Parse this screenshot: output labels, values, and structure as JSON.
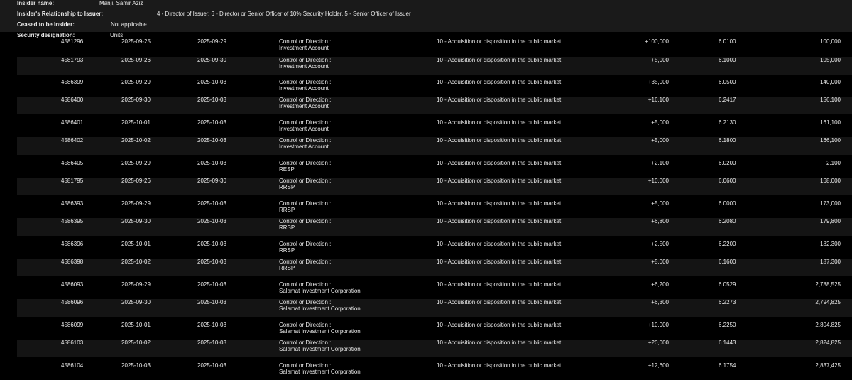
{
  "colors": {
    "page_background": "#000000",
    "header_background": "#1a1a1a",
    "row_band": "#141414",
    "text": "#e8e8e8"
  },
  "insider": {
    "name_label": "Insider name:",
    "name": "Manji, Samir Aziz",
    "relationship_label": "Insider's Relationship to Issuer:",
    "relationship": "4 - Director of Issuer, 6 - Director or Senior Officer of 10% Security Holder, 5 - Senior Officer of Issuer",
    "ceased_label": "Ceased to be Insider:",
    "ceased": "Not applicable",
    "security_label": "Security designation:",
    "security": "Units"
  },
  "transactions": [
    {
      "id": "4581296",
      "transaction_date": "2025-09-25",
      "filing_date": "2025-09-29",
      "ownership": "Control or Direction :",
      "holder": "Investment Account",
      "nature": "10 - Acquisition or disposition in the public market",
      "number": "+100,000",
      "price": "6.0100",
      "balance": "100,000"
    },
    {
      "id": "4581793",
      "transaction_date": "2025-09-26",
      "filing_date": "2025-09-30",
      "ownership": "Control or Direction :",
      "holder": "Investment Account",
      "nature": "10 - Acquisition or disposition in the public market",
      "number": "+5,000",
      "price": "6.1000",
      "balance": "105,000"
    },
    {
      "id": "4586399",
      "transaction_date": "2025-09-29",
      "filing_date": "2025-10-03",
      "ownership": "Control or Direction :",
      "holder": "Investment Account",
      "nature": "10 - Acquisition or disposition in the public market",
      "number": "+35,000",
      "price": "6.0500",
      "balance": "140,000"
    },
    {
      "id": "4586400",
      "transaction_date": "2025-09-30",
      "filing_date": "2025-10-03",
      "ownership": "Control or Direction :",
      "holder": "Investment Account",
      "nature": "10 - Acquisition or disposition in the public market",
      "number": "+16,100",
      "price": "6.2417",
      "balance": "156,100"
    },
    {
      "id": "4586401",
      "transaction_date": "2025-10-01",
      "filing_date": "2025-10-03",
      "ownership": "Control or Direction :",
      "holder": "Investment Account",
      "nature": "10 - Acquisition or disposition in the public market",
      "number": "+5,000",
      "price": "6.2130",
      "balance": "161,100"
    },
    {
      "id": "4586402",
      "transaction_date": "2025-10-02",
      "filing_date": "2025-10-03",
      "ownership": "Control or Direction :",
      "holder": "Investment Account",
      "nature": "10 - Acquisition or disposition in the public market",
      "number": "+5,000",
      "price": "6.1800",
      "balance": "166,100"
    },
    {
      "id": "4586405",
      "transaction_date": "2025-09-29",
      "filing_date": "2025-10-03",
      "ownership": "Control or Direction :",
      "holder": "RESP",
      "nature": "10 - Acquisition or disposition in the public market",
      "number": "+2,100",
      "price": "6.0200",
      "balance": "2,100"
    },
    {
      "id": "4581795",
      "transaction_date": "2025-09-26",
      "filing_date": "2025-09-30",
      "ownership": "Control or Direction :",
      "holder": "RRSP",
      "nature": "10 - Acquisition or disposition in the public market",
      "number": "+10,000",
      "price": "6.0600",
      "balance": "168,000"
    },
    {
      "id": "4586393",
      "transaction_date": "2025-09-29",
      "filing_date": "2025-10-03",
      "ownership": "Control or Direction :",
      "holder": "RRSP",
      "nature": "10 - Acquisition or disposition in the public market",
      "number": "+5,000",
      "price": "6.0000",
      "balance": "173,000"
    },
    {
      "id": "4586395",
      "transaction_date": "2025-09-30",
      "filing_date": "2025-10-03",
      "ownership": "Control or Direction :",
      "holder": "RRSP",
      "nature": "10 - Acquisition or disposition in the public market",
      "number": "+6,800",
      "price": "6.2080",
      "balance": "179,800"
    },
    {
      "id": "4586396",
      "transaction_date": "2025-10-01",
      "filing_date": "2025-10-03",
      "ownership": "Control or Direction :",
      "holder": "RRSP",
      "nature": "10 - Acquisition or disposition in the public market",
      "number": "+2,500",
      "price": "6.2200",
      "balance": "182,300"
    },
    {
      "id": "4586398",
      "transaction_date": "2025-10-02",
      "filing_date": "2025-10-03",
      "ownership": "Control or Direction :",
      "holder": "RRSP",
      "nature": "10 - Acquisition or disposition in the public market",
      "number": "+5,000",
      "price": "6.1600",
      "balance": "187,300"
    },
    {
      "id": "4586093",
      "transaction_date": "2025-09-29",
      "filing_date": "2025-10-03",
      "ownership": "Control or Direction :",
      "holder": "Salamat Investment Corporation",
      "nature": "10 - Acquisition or disposition in the public market",
      "number": "+6,200",
      "price": "6.0529",
      "balance": "2,788,525"
    },
    {
      "id": "4586096",
      "transaction_date": "2025-09-30",
      "filing_date": "2025-10-03",
      "ownership": "Control or Direction :",
      "holder": "Salamat Investment Corporation",
      "nature": "10 - Acquisition or disposition in the public market",
      "number": "+6,300",
      "price": "6.2273",
      "balance": "2,794,825"
    },
    {
      "id": "4586099",
      "transaction_date": "2025-10-01",
      "filing_date": "2025-10-03",
      "ownership": "Control or Direction :",
      "holder": "Salamat Investment Corporation",
      "nature": "10 - Acquisition or disposition in the public market",
      "number": "+10,000",
      "price": "6.2250",
      "balance": "2,804,825"
    },
    {
      "id": "4586103",
      "transaction_date": "2025-10-02",
      "filing_date": "2025-10-03",
      "ownership": "Control or Direction :",
      "holder": "Salamat Investment Corporation",
      "nature": "10 - Acquisition or disposition in the public market",
      "number": "+20,000",
      "price": "6.1443",
      "balance": "2,824,825"
    },
    {
      "id": "4586104",
      "transaction_date": "2025-10-03",
      "filing_date": "2025-10-03",
      "ownership": "Control or Direction :",
      "holder": "Salamat Investment Corporation",
      "nature": "10 - Acquisition or disposition in the public market",
      "number": "+12,600",
      "price": "6.1754",
      "balance": "2,837,425"
    }
  ]
}
